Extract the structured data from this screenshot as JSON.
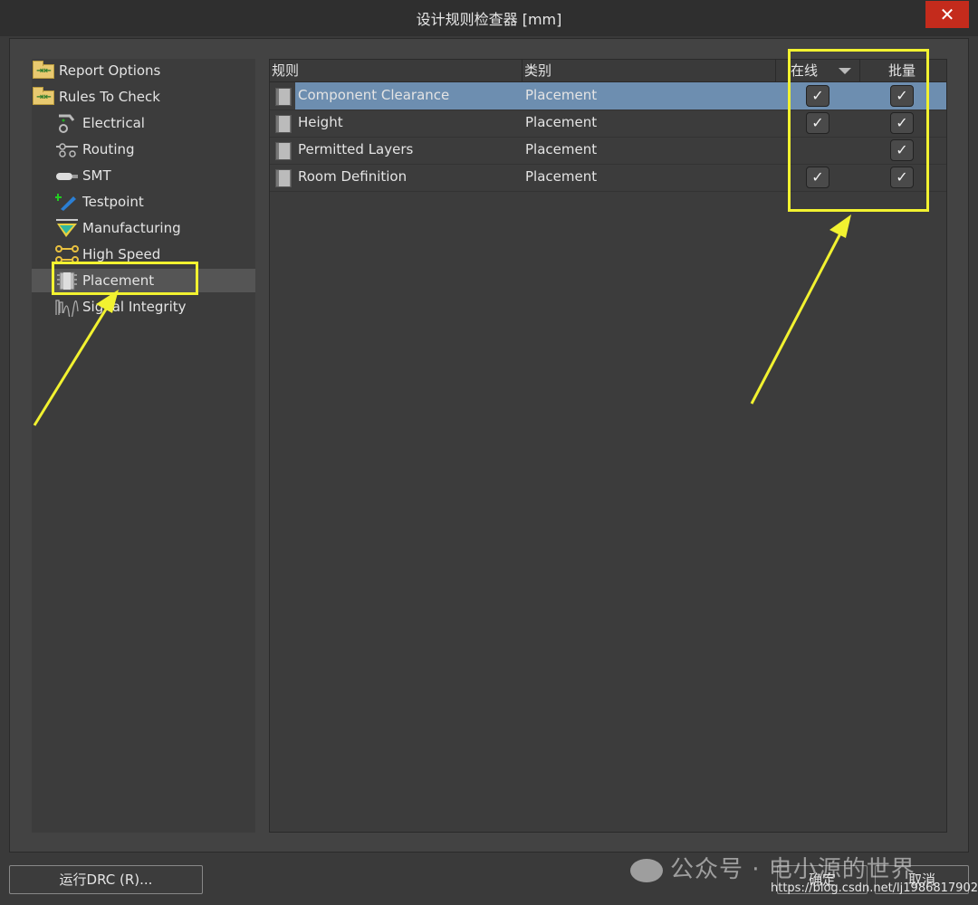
{
  "window": {
    "title": "设计规则检查器 [mm]",
    "close_glyph": "✕"
  },
  "tree": [
    {
      "label": "Report Options",
      "icon": "folder-icon",
      "selected": false
    },
    {
      "label": "Rules To Check",
      "icon": "folder-icon",
      "selected": false
    },
    {
      "label": "Electrical",
      "icon": "electrical-icon",
      "selected": false
    },
    {
      "label": "Routing",
      "icon": "routing-icon",
      "selected": false
    },
    {
      "label": "SMT",
      "icon": "smt-icon",
      "selected": false
    },
    {
      "label": "Testpoint",
      "icon": "testpoint-icon",
      "selected": false
    },
    {
      "label": "Manufacturing",
      "icon": "manufacturing-icon",
      "selected": false
    },
    {
      "label": "High Speed",
      "icon": "high-speed-icon",
      "selected": false
    },
    {
      "label": "Placement",
      "icon": "placement-icon",
      "selected": true
    },
    {
      "label": "Signal Integrity",
      "icon": "signal-integrity-icon",
      "selected": false
    }
  ],
  "grid": {
    "columns": [
      "规则",
      "类别",
      "在线",
      "批量"
    ],
    "rows": [
      {
        "rule": "Component Clearance",
        "category": "Placement",
        "online": true,
        "batch": true,
        "selected": true
      },
      {
        "rule": "Height",
        "category": "Placement",
        "online": true,
        "batch": true,
        "selected": false
      },
      {
        "rule": "Permitted Layers",
        "category": "Placement",
        "online": false,
        "batch": true,
        "selected": false
      },
      {
        "rule": "Room Definition",
        "category": "Placement",
        "online": true,
        "batch": true,
        "selected": false
      }
    ],
    "check_glyph": "✓"
  },
  "footer": {
    "run_drc_label": "运行DRC (R)...",
    "ok_label": "确定",
    "cancel_label": "取消"
  },
  "overlay": {
    "watermark_text": "公众号 · 电小源的世界",
    "url_text": "https://blog.csdn.net/lj1986817902",
    "highlight_color": "#f2f230"
  }
}
